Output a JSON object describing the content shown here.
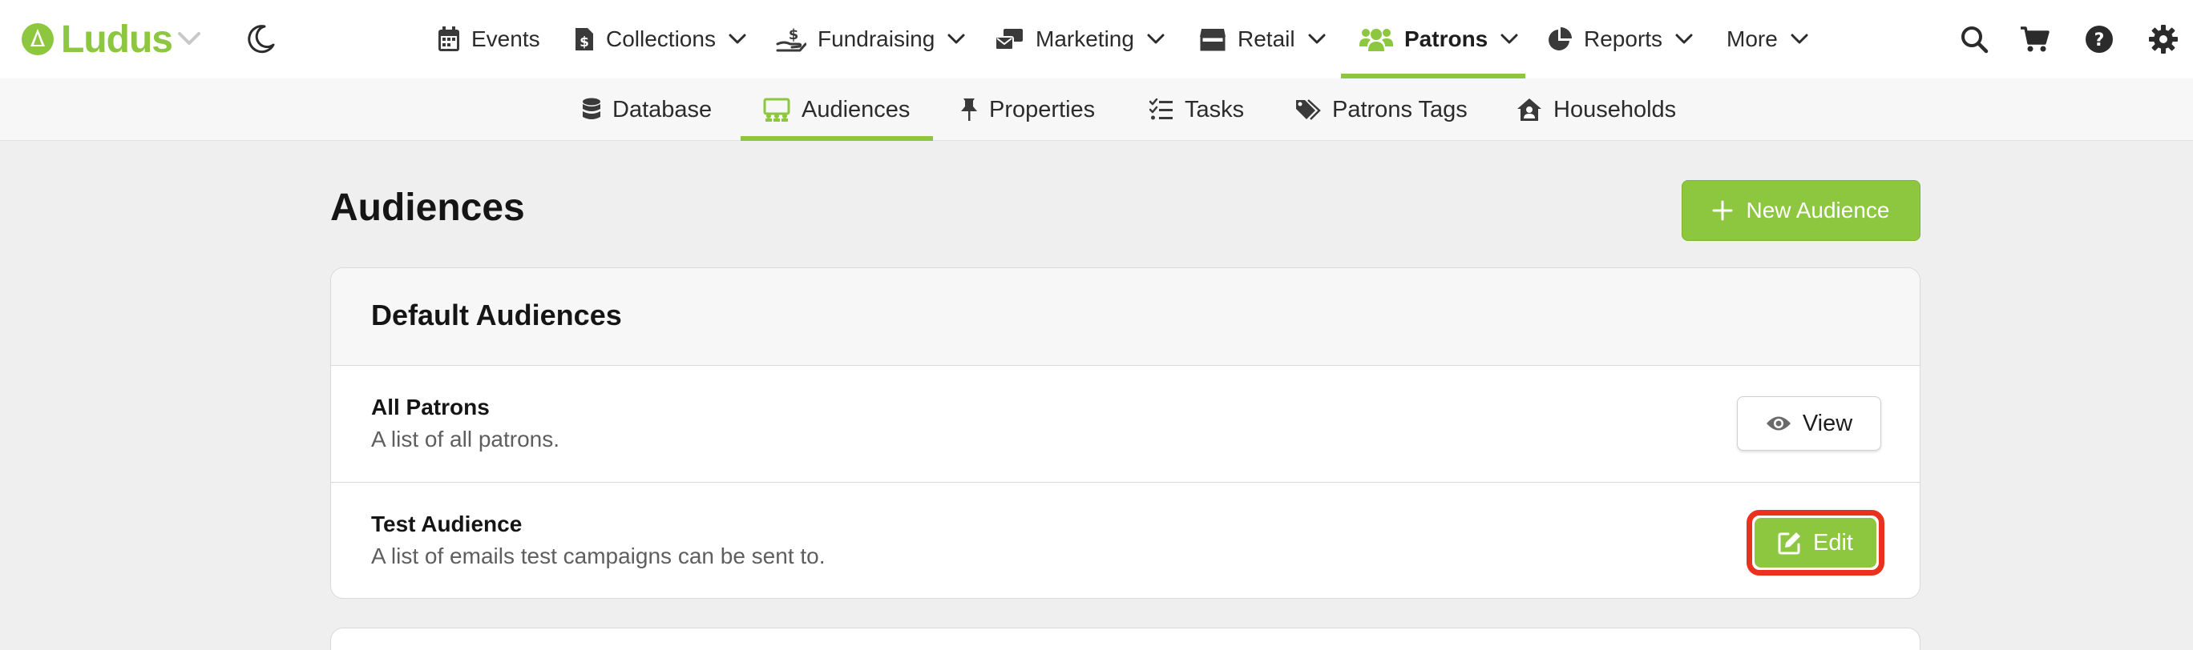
{
  "brand": {
    "name": "Ludus",
    "color": "#8dc63f"
  },
  "top_nav": {
    "items": [
      {
        "label": "Events",
        "icon": "calendar-icon"
      },
      {
        "label": "Collections",
        "icon": "file-dollar-icon"
      },
      {
        "label": "Fundraising",
        "icon": "hand-dollar-icon"
      },
      {
        "label": "Marketing",
        "icon": "mail-bulk-icon"
      },
      {
        "label": "Retail",
        "icon": "store-icon"
      },
      {
        "label": "Patrons",
        "icon": "users-icon",
        "active": true
      },
      {
        "label": "Reports",
        "icon": "pie-chart-icon"
      },
      {
        "label": "More"
      }
    ],
    "utilities": [
      "search-icon",
      "cart-icon",
      "help-icon",
      "gear-icon"
    ]
  },
  "sub_nav": {
    "items": [
      {
        "label": "Database",
        "icon": "database-icon"
      },
      {
        "label": "Audiences",
        "icon": "audience-icon",
        "active": true
      },
      {
        "label": "Properties",
        "icon": "thumbtack-icon"
      },
      {
        "label": "Tasks",
        "icon": "tasks-icon"
      },
      {
        "label": "Patrons Tags",
        "icon": "tags-icon"
      },
      {
        "label": "Households",
        "icon": "house-user-icon"
      }
    ]
  },
  "main": {
    "title": "Audiences",
    "new_button": "New Audience",
    "card": {
      "title": "Default Audiences",
      "rows": [
        {
          "name": "All Patrons",
          "description": "A list of all patrons.",
          "action": "View"
        },
        {
          "name": "Test Audience",
          "description": "A list of emails test campaigns can be sent to.",
          "action": "Edit"
        }
      ]
    }
  },
  "colors": {
    "accent": "#8dc63f",
    "highlight_outline": "#e8321d",
    "page_bg": "#efefef"
  }
}
